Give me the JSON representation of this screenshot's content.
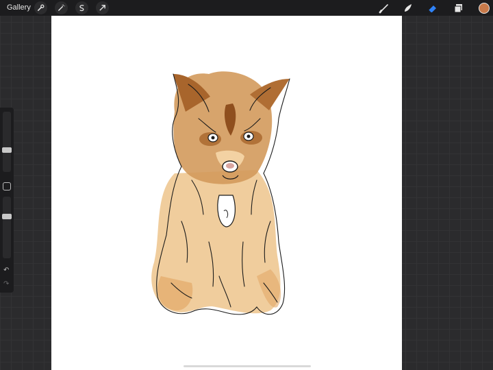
{
  "topbar": {
    "gallery_label": "Gallery",
    "left_tools": [
      "wrench-icon",
      "magic-wand-icon",
      "selection-icon",
      "transform-arrow-icon"
    ],
    "right_tools": [
      "brush-icon",
      "smudge-icon",
      "eraser-icon",
      "layers-icon"
    ],
    "active_tool": "eraser-icon",
    "current_color": "#c87a4a"
  },
  "sidebar": {
    "brush_size": 0.35,
    "opacity": 0.7,
    "buttons": [
      "modify-square-icon",
      "undo-icon",
      "redo-icon"
    ]
  },
  "canvas": {
    "subject": "yorkie-dog-illustration",
    "colors": {
      "fur_dark": "#a8652c",
      "fur_mid": "#d39a5c",
      "fur_light": "#edc48c",
      "line": "#1a1a1a"
    }
  },
  "accent": "#2f82f7"
}
